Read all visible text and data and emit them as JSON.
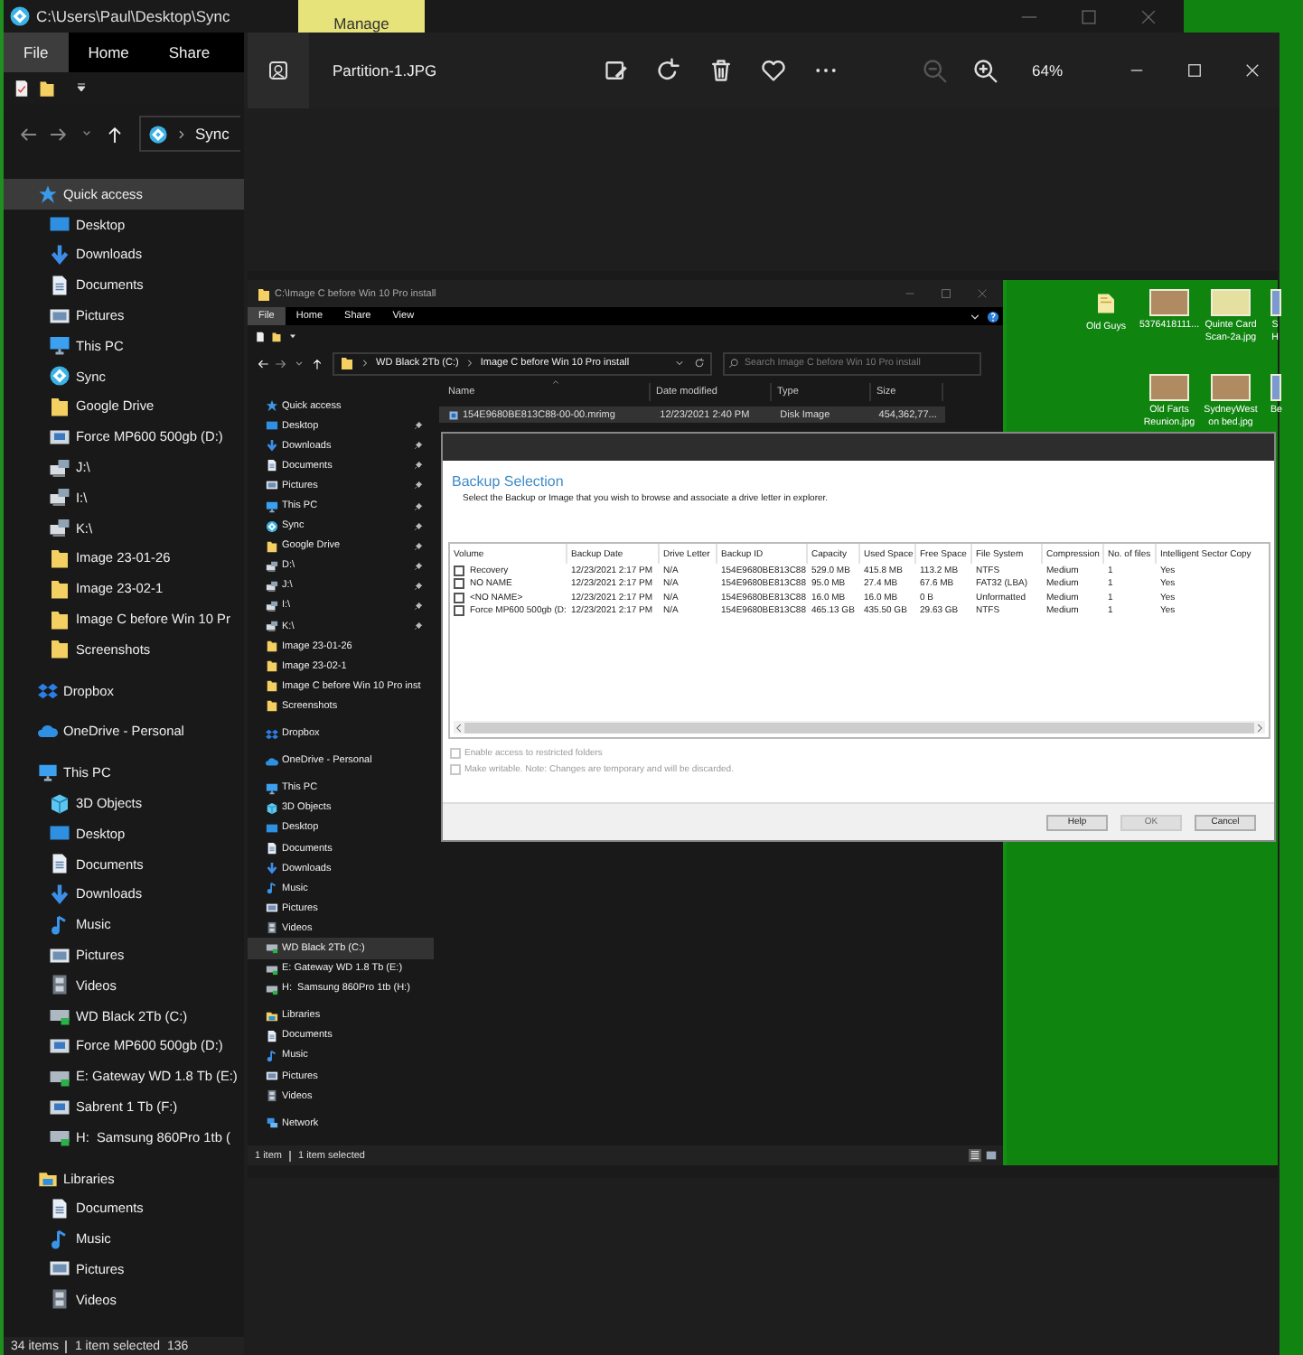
{
  "back_window": {
    "title": "C:\\Users\\Paul\\Desktop\\Sync",
    "context_tab": "Manage",
    "ribbon_tabs": [
      {
        "label": "File",
        "kind": "file-menu"
      },
      {
        "label": "Home",
        "kind": "tab"
      },
      {
        "label": "Share",
        "kind": "tab"
      }
    ],
    "address": "Sync",
    "nav_pane": [
      {
        "label": "Quick access",
        "kind": "star",
        "selected": true,
        "children": [
          {
            "label": "Desktop",
            "kind": "desktop",
            "selected": false
          },
          {
            "label": "Downloads",
            "kind": "downloads",
            "selected": false
          },
          {
            "label": "Documents",
            "kind": "documents",
            "selected": false
          },
          {
            "label": "Pictures",
            "kind": "pictures",
            "selected": false
          },
          {
            "label": "This PC",
            "kind": "pc",
            "selected": false
          },
          {
            "label": "Sync",
            "kind": "sync",
            "selected": false
          },
          {
            "label": "Google Drive",
            "kind": "folder",
            "selected": false
          },
          {
            "label": "Force MP600 500gb (D:)",
            "kind": "drive",
            "selected": false
          },
          {
            "label": "J:\\",
            "kind": "netdrive",
            "selected": false
          },
          {
            "label": "I:\\",
            "kind": "netdrive",
            "selected": false
          },
          {
            "label": "K:\\",
            "kind": "netdrive",
            "selected": false
          },
          {
            "label": "Image 23-01-26",
            "kind": "folder",
            "selected": false
          },
          {
            "label": "Image 23-02-1",
            "kind": "folder",
            "selected": false
          },
          {
            "label": "Image C before Win 10 Pr",
            "kind": "folder",
            "selected": false
          },
          {
            "label": "Screenshots",
            "kind": "folder",
            "selected": false
          }
        ]
      },
      {
        "label": "Dropbox",
        "kind": "dropbox",
        "selected": false
      },
      {
        "label": "OneDrive - Personal",
        "kind": "onedrive",
        "selected": false
      },
      {
        "label": "This PC",
        "kind": "pc",
        "selected": false,
        "children": [
          {
            "label": "3D Objects",
            "kind": "objects",
            "selected": false
          },
          {
            "label": "Desktop",
            "kind": "desktop",
            "selected": false
          },
          {
            "label": "Documents",
            "kind": "documents",
            "selected": false
          },
          {
            "label": "Downloads",
            "kind": "downloads",
            "selected": false
          },
          {
            "label": "Music",
            "kind": "music",
            "selected": false
          },
          {
            "label": "Pictures",
            "kind": "pictures",
            "selected": false
          },
          {
            "label": "Videos",
            "kind": "videos",
            "selected": false
          },
          {
            "label": "WD Black 2Tb (C:)",
            "kind": "sysdrive",
            "selected": false
          },
          {
            "label": "Force MP600 500gb (D:)",
            "kind": "drive",
            "selected": false
          },
          {
            "label": "E: Gateway WD 1.8 Tb (E:)",
            "kind": "sysdrive",
            "selected": false
          },
          {
            "label": "Sabrent 1 Tb (F:)",
            "kind": "drive",
            "selected": false
          },
          {
            "label": "H:  Samsung 860Pro 1tb (",
            "kind": "sysdrive",
            "selected": false
          }
        ]
      },
      {
        "label": "Libraries",
        "kind": "libraries",
        "selected": false,
        "children": [
          {
            "label": "Documents",
            "kind": "documents",
            "selected": false
          },
          {
            "label": "Music",
            "kind": "music",
            "selected": false
          },
          {
            "label": "Pictures",
            "kind": "pictures",
            "selected": false
          },
          {
            "label": "Videos",
            "kind": "videos",
            "selected": false
          }
        ]
      }
    ],
    "status_bar": [
      "34 items",
      "1 item selected  136"
    ]
  },
  "viewer": {
    "file_name": "Partition-1.JPG",
    "zoom_out": {
      "disabled": true
    },
    "zoom": "64%",
    "image": {
      "explorer": {
        "title": "C:\\Image C before Win 10 Pro install",
        "ribbon_tabs": [
          {
            "label": "File",
            "kind": "file-menu"
          },
          {
            "label": "Home",
            "kind": "tab"
          },
          {
            "label": "Share",
            "kind": "tab"
          },
          {
            "label": "View",
            "kind": "tab"
          }
        ],
        "address": [
          "WD Black 2Tb (C:)",
          "Image C before Win 10 Pro install"
        ],
        "search": {
          "placeholder": "Search Image C before Win 10 Pro install"
        },
        "columns": [
          "Name",
          "Date modified",
          "Type",
          "Size"
        ],
        "files": [
          {
            "cells": [
              "154E9680BE813C88-00-00.mrimg",
              "12/23/2021 2:40 PM",
              "Disk Image",
              "454,362,77..."
            ],
            "selected": true
          }
        ],
        "nav_pane": [
          {
            "label": "Quick access",
            "kind": "star",
            "selected": false,
            "children": [
              {
                "label": "Desktop",
                "kind": "desktop",
                "selected": false,
                "pinned": true
              },
              {
                "label": "Downloads",
                "kind": "downloads",
                "selected": false,
                "pinned": true
              },
              {
                "label": "Documents",
                "kind": "documents",
                "selected": false,
                "pinned": true
              },
              {
                "label": "Pictures",
                "kind": "pictures",
                "selected": false,
                "pinned": true
              },
              {
                "label": "This PC",
                "kind": "pc",
                "selected": false,
                "pinned": true
              },
              {
                "label": "Sync",
                "kind": "sync",
                "selected": false,
                "pinned": true
              },
              {
                "label": "Google Drive",
                "kind": "folder",
                "selected": false,
                "pinned": true
              },
              {
                "label": "D:\\",
                "kind": "netdrive",
                "selected": false,
                "pinned": true
              },
              {
                "label": "J:\\",
                "kind": "netdrive",
                "selected": false,
                "pinned": true
              },
              {
                "label": "I:\\",
                "kind": "netdrive",
                "selected": false,
                "pinned": true
              },
              {
                "label": "K:\\",
                "kind": "netdrive",
                "selected": false,
                "pinned": true
              },
              {
                "label": "Image 23-01-26",
                "kind": "folder",
                "selected": false,
                "pinned": false
              },
              {
                "label": "Image 23-02-1",
                "kind": "folder",
                "selected": false,
                "pinned": false
              },
              {
                "label": "Image C before Win 10 Pro inst",
                "kind": "folder",
                "selected": false,
                "pinned": false
              },
              {
                "label": "Screenshots",
                "kind": "folder",
                "selected": false,
                "pinned": false
              }
            ]
          },
          {
            "label": "Dropbox",
            "kind": "dropbox",
            "selected": false
          },
          {
            "label": "OneDrive - Personal",
            "kind": "onedrive",
            "selected": false
          },
          {
            "label": "This PC",
            "kind": "pc",
            "selected": false,
            "children": [
              {
                "label": "3D Objects",
                "kind": "objects",
                "selected": false
              },
              {
                "label": "Desktop",
                "kind": "desktop",
                "selected": false
              },
              {
                "label": "Documents",
                "kind": "documents",
                "selected": false
              },
              {
                "label": "Downloads",
                "kind": "downloads",
                "selected": false
              },
              {
                "label": "Music",
                "kind": "music",
                "selected": false
              },
              {
                "label": "Pictures",
                "kind": "pictures",
                "selected": false
              },
              {
                "label": "Videos",
                "kind": "videos",
                "selected": false
              },
              {
                "label": "WD Black 2Tb (C:)",
                "kind": "sysdrive",
                "selected": true
              },
              {
                "label": "E: Gateway WD 1.8 Tb (E:)",
                "kind": "sysdrive",
                "selected": false
              },
              {
                "label": "H:  Samsung 860Pro 1tb (H:)",
                "kind": "sysdrive",
                "selected": false
              }
            ]
          },
          {
            "label": "Libraries",
            "kind": "libraries",
            "selected": false,
            "children": [
              {
                "label": "Documents",
                "kind": "documents",
                "selected": false
              },
              {
                "label": "Music",
                "kind": "music",
                "selected": false
              },
              {
                "label": "Pictures",
                "kind": "pictures",
                "selected": false
              },
              {
                "label": "Videos",
                "kind": "videos",
                "selected": false
              }
            ]
          },
          {
            "label": "Network",
            "kind": "network",
            "selected": false
          }
        ],
        "status_bar": [
          "1 item",
          "1 item selected"
        ]
      },
      "desktop_icons": [
        {
          "label": "Old Guys",
          "kind": "folder"
        },
        {
          "label": "5376418111...",
          "kind": "photo"
        },
        {
          "label": "Quinte Card Scan-2a.jpg",
          "kind": "photo"
        },
        {
          "label": "S H",
          "kind": "photo"
        },
        {
          "label": "Old Farts Reunion.jpg",
          "kind": "photo"
        },
        {
          "label": "SydneyWest on bed.jpg",
          "kind": "photo"
        },
        {
          "label": "Be",
          "kind": "photo"
        }
      ],
      "dialog": {
        "title": "Backup Selection",
        "subtitle": "Select the Backup or Image that you wish to browse and associate a drive letter in explorer.",
        "columns": [
          "Volume",
          "Backup Date",
          "Drive Letter",
          "Backup ID",
          "Capacity",
          "Used Space",
          "Free Space",
          "File System",
          "Compression",
          "No. of files",
          "Intelligent Sector Copy"
        ],
        "rows": [
          {
            "checked": false,
            "cells": [
              "Recovery",
              "12/23/2021 2:17 PM",
              "N/A",
              "154E9680BE813C88",
              "529.0 MB",
              "415.8 MB",
              "113.2 MB",
              "NTFS",
              "Medium",
              "1",
              "Yes"
            ]
          },
          {
            "checked": false,
            "cells": [
              "NO NAME",
              "12/23/2021 2:17 PM",
              "N/A",
              "154E9680BE813C88",
              "95.0 MB",
              "27.4 MB",
              "67.6 MB",
              "FAT32 (LBA)",
              "Medium",
              "1",
              "Yes"
            ]
          },
          {
            "checked": false,
            "cells": [
              "<NO NAME>",
              "12/23/2021 2:17 PM",
              "N/A",
              "154E9680BE813C88",
              "16.0 MB",
              "16.0 MB",
              "0 B",
              "Unformatted",
              "Medium",
              "1",
              "Yes"
            ]
          },
          {
            "checked": false,
            "cells": [
              "Force MP600 500gb (D:",
              "12/23/2021 2:17 PM",
              "N/A",
              "154E9680BE813C88",
              "465.13 GB",
              "435.50 GB",
              "29.63 GB",
              "NTFS",
              "Medium",
              "1",
              "Yes"
            ]
          }
        ],
        "options": [
          {
            "label": "Enable access to restricted folders",
            "checked": false,
            "disabled": true
          },
          {
            "label": "Make writable. Note: Changes are temporary and will be discarded.",
            "checked": false,
            "disabled": true
          }
        ],
        "buttons": [
          {
            "label": "Help",
            "disabled": false
          },
          {
            "label": "OK",
            "disabled": true
          },
          {
            "label": "Cancel",
            "disabled": false
          }
        ]
      }
    }
  }
}
